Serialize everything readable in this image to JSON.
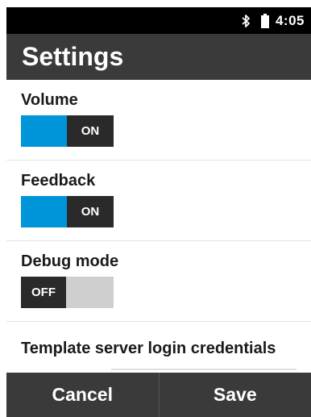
{
  "status_bar": {
    "time": "4:05",
    "icons": [
      "bluetooth-icon",
      "battery-icon"
    ]
  },
  "app_bar": {
    "title": "Settings"
  },
  "settings": {
    "volume": {
      "label": "Volume",
      "state": "ON",
      "enabled": true
    },
    "feedback": {
      "label": "Feedback",
      "state": "ON",
      "enabled": true
    },
    "debug_mode": {
      "label": "Debug mode",
      "state": "OFF",
      "enabled": false
    },
    "credentials": {
      "label": "Template server login credentials"
    }
  },
  "bottom_bar": {
    "cancel_label": "Cancel",
    "save_label": "Save"
  },
  "colors": {
    "accent": "#0094d9",
    "bar": "#3a3a3a",
    "knob": "#2a2a2a",
    "track_off": "#cfcfcf"
  }
}
